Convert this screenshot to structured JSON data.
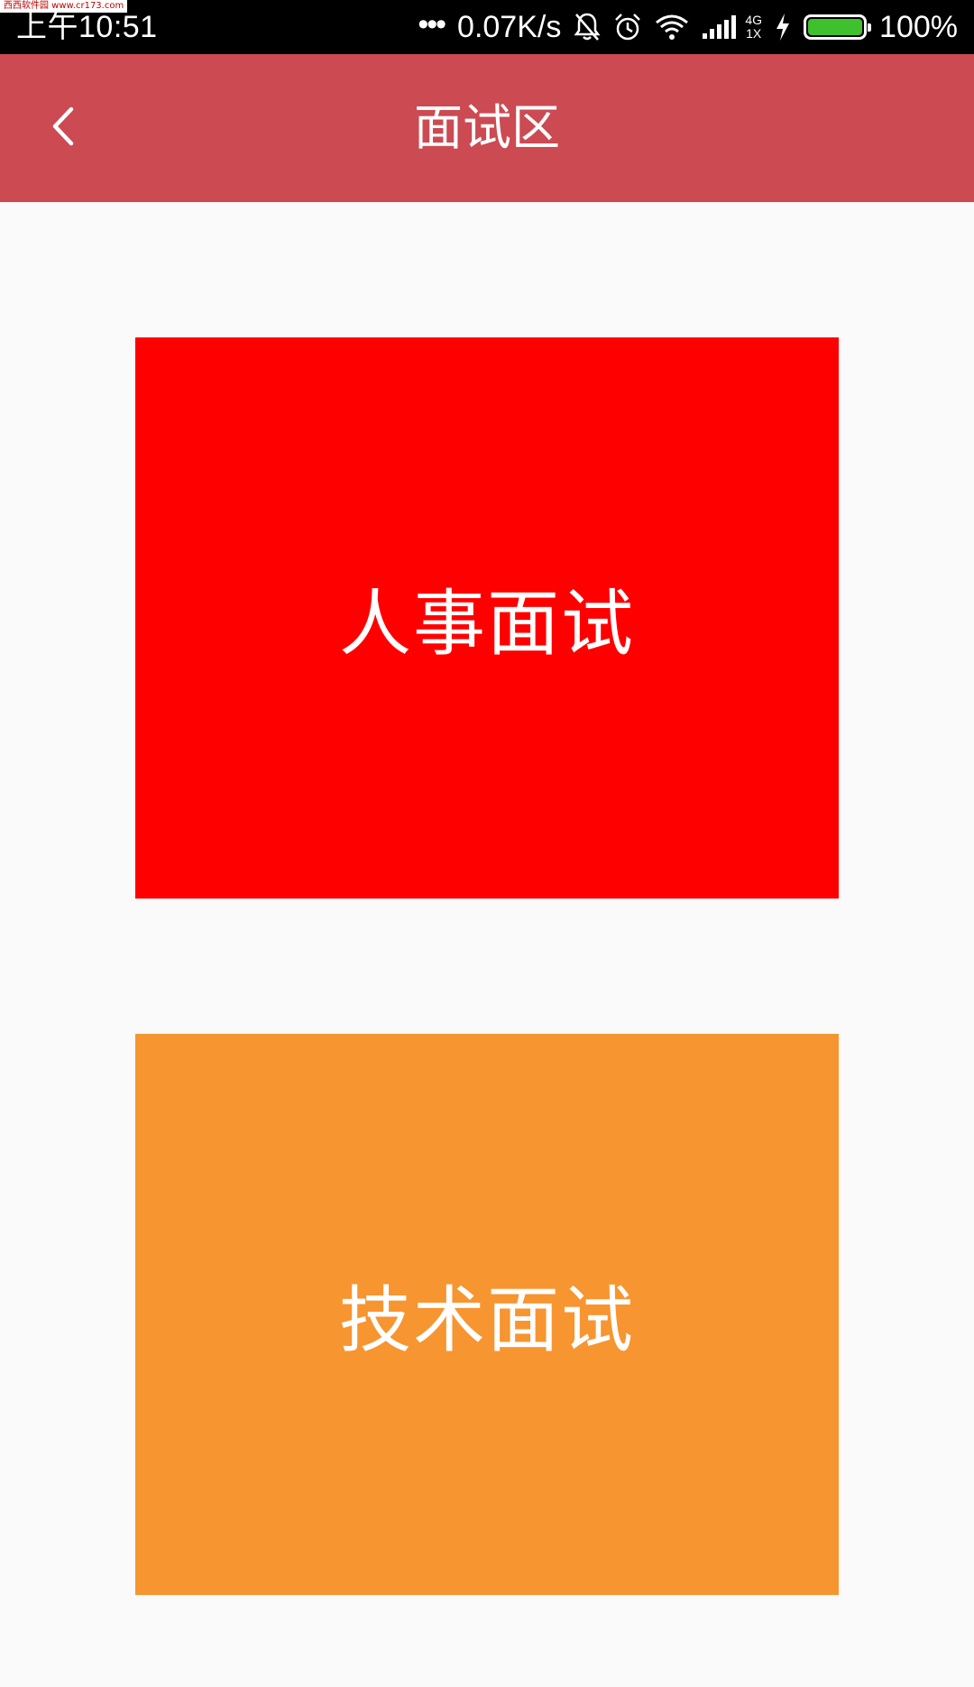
{
  "status_bar": {
    "time": "上午10:51",
    "watermark": "西西软件园 www.cr173.com",
    "overflow": "•••",
    "net_speed": "0.07K/s",
    "icons": [
      "notifications-off-icon",
      "alarm-icon",
      "wifi-icon",
      "signal-icon",
      "charging-icon",
      "battery-icon"
    ],
    "network_type_top": "4G",
    "network_type_bottom": "1X",
    "battery_percent": "100%",
    "battery_level": 1.0,
    "battery_color": "#3fc02d"
  },
  "app_bar": {
    "title": "面试区",
    "background": "#cc4a52",
    "back_icon": "chevron-left-icon"
  },
  "cards": [
    {
      "label": "人事面试",
      "color": "#ff0000"
    },
    {
      "label": "技术面试",
      "color": "#f79530"
    }
  ]
}
